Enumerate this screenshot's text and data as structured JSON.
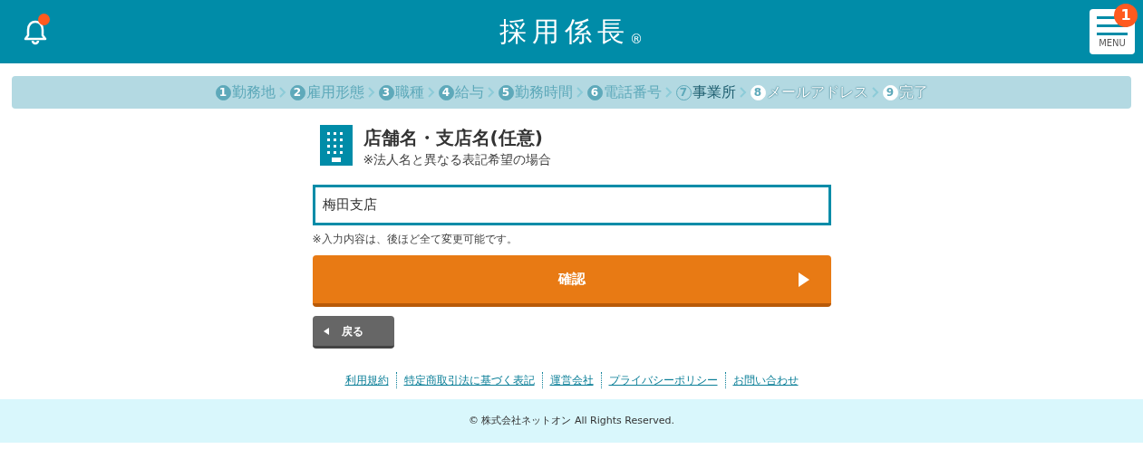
{
  "header": {
    "logo": "採用係長",
    "logo_mark": "®",
    "notification": true,
    "menu_badge": "1",
    "menu_label": "MENU"
  },
  "steps": [
    {
      "number": "1",
      "label": "勤務地",
      "completed": true,
      "selected": false
    },
    {
      "number": "2",
      "label": "雇用形態",
      "completed": true,
      "selected": false
    },
    {
      "number": "3",
      "label": "職種",
      "completed": true,
      "selected": false
    },
    {
      "number": "4",
      "label": "給与",
      "completed": true,
      "selected": false
    },
    {
      "number": "5",
      "label": "勤務時間",
      "completed": true,
      "selected": false
    },
    {
      "number": "6",
      "label": "電話番号",
      "completed": true,
      "selected": false
    },
    {
      "number": "7",
      "label": "事業所",
      "completed": false,
      "selected": true
    },
    {
      "number": "8",
      "label": "メールアドレス",
      "completed": false,
      "selected": false
    },
    {
      "number": "9",
      "label": "完了",
      "completed": false,
      "selected": false
    }
  ],
  "form": {
    "title": "店舗名・支店名(任意)",
    "subtitle": "※法人名と異なる表記希望の場合",
    "value": "梅田支店",
    "note": "※入力内容は、後ほど全て変更可能です。",
    "confirm_button": "確認",
    "back_button": "戻る"
  },
  "footer_links": [
    "利用規約",
    "特定商取引法に基づく表記",
    "運営会社",
    "プライバシーポリシー",
    "お問い合わせ"
  ],
  "copyright": "© 株式会社ネットオン All Rights Reserved."
}
